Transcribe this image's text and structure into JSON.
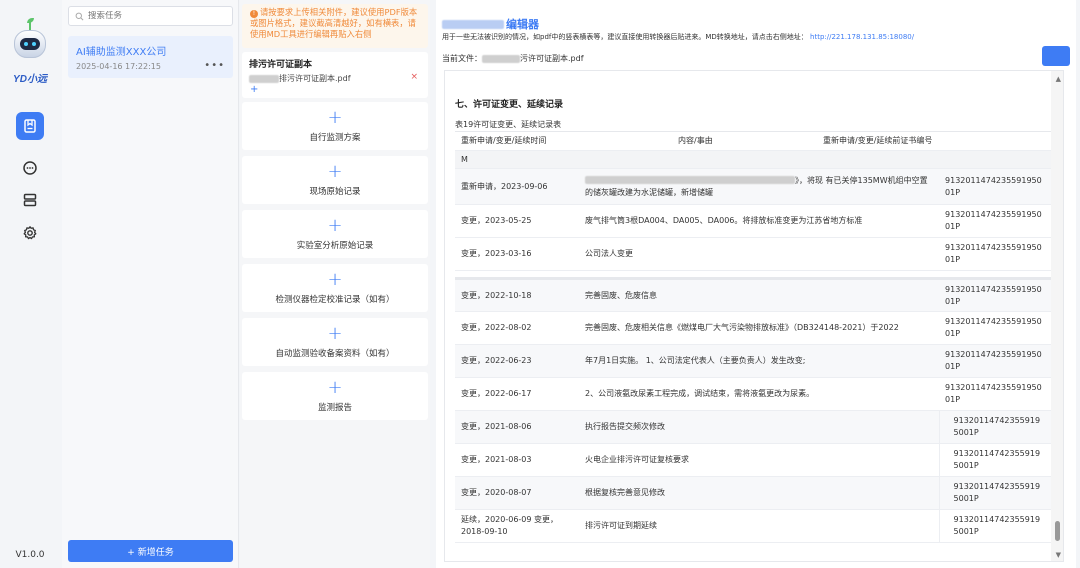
{
  "app": {
    "logo_text": "YD小远",
    "version": "V1.0.0"
  },
  "nav": {
    "items": [
      {
        "name": "document-icon",
        "active": true
      },
      {
        "name": "chat-icon",
        "active": false
      },
      {
        "name": "storage-icon",
        "active": false
      },
      {
        "name": "gear-icon",
        "active": false
      }
    ]
  },
  "tasks": {
    "search_placeholder": "搜索任务",
    "items": [
      {
        "title": "AI辅助监测XXX公司",
        "time": "2025-04-16 17:22:15",
        "more": "•••"
      }
    ],
    "add_label": "+ 新增任务"
  },
  "materials": {
    "notice": "请按要求上传相关附件，建议使用PDF版本或图片格式，建议截高清越好，如有横表，请使用MD工具进行编辑再贴入右侧",
    "permit": {
      "title": "排污许可证副本",
      "file_name": "排污许可证副本.pdf",
      "remove": "×",
      "add": "+"
    },
    "cards": [
      {
        "plus": "+",
        "label": "自行监测方案"
      },
      {
        "plus": "+",
        "label": "现场原始记录"
      },
      {
        "plus": "+",
        "label": "实验室分析原始记录"
      },
      {
        "plus": "+",
        "label": "检测仪器检定校准记录（如有）"
      },
      {
        "plus": "+",
        "label": "自动监测验收备案资料（如有）"
      },
      {
        "plus": "+",
        "label": "监测报告"
      }
    ]
  },
  "editor": {
    "title": "编辑器",
    "desc": "用于一些无法被识别的情况，如pdf中的竖表横表等，建议直接使用转换器后贴进来。MD转换地址，请点击右侧地址：",
    "desc_link": "http://221.178.131.85:18080/",
    "current_file_label": "当前文件：",
    "current_file_name": "污许可证副本.pdf",
    "section_title": "七、许可证变更、延续记录",
    "table_caption": "表19许可证变更、延续记录表",
    "table": {
      "headers": [
        "重新申请/变更/延续时间",
        "内容/事由",
        "重新申请/变更/延续前证书编号"
      ],
      "m_row": "M",
      "rows": [
        {
          "time": "重新申请，2023-09-06",
          "content": "》，将现 有已关停135MW机组中空置的储灰罐改建为水泥储罐，新增储罐",
          "cert": "913201147423559195001P"
        },
        {
          "time": "变更，2023-05-25",
          "content": "废气排气筒3根DA004、DA005、DA006。将排放标准变更为江苏省地方标准",
          "cert": "913201147423559195001P"
        },
        {
          "time": "变更，2023-03-16",
          "content": "公司法人变更",
          "cert": "913201147423559195001P"
        },
        {
          "time": "变更，2022-10-18",
          "content": "完善固废、危废信息",
          "cert": "913201147423559195001P"
        },
        {
          "time": "变更，2022-08-02",
          "content": "完善固废、危废相关信息《燃煤电厂大气污染物排放标准》（DB324148-2021）于2022",
          "cert": "913201147423559195001P"
        },
        {
          "time": "变更，2022-06-23",
          "content": "年7月1日实施。 1、公司法定代表人（主要负责人）发生改变;",
          "cert": "913201147423559195001P"
        },
        {
          "time": "变更，2022-06-17",
          "content": "2、公司液氨改尿素工程完成，调试结束，需将液氨更改为尿素。",
          "cert": "913201147423559195001P"
        },
        {
          "time": "变更，2021-08-06",
          "content": "执行报告提交频次修改",
          "cert": "913201147423559195001P"
        },
        {
          "time": "变更，2021-08-03",
          "content": "火电企业排污许可证复核要求",
          "cert": "913201147423559195001P"
        },
        {
          "time": "变更，2020-08-07",
          "content": "根据复核完善意见修改",
          "cert": "913201147423559195001P"
        },
        {
          "time": "延续，2020-06-09 变更，2018-09-10",
          "content": "排污许可证到期延续",
          "cert": "913201147423559195001P"
        }
      ]
    }
  },
  "colors": {
    "accent": "#3e7cf4",
    "warning": "#f08a3a",
    "danger": "#e45a5a"
  }
}
